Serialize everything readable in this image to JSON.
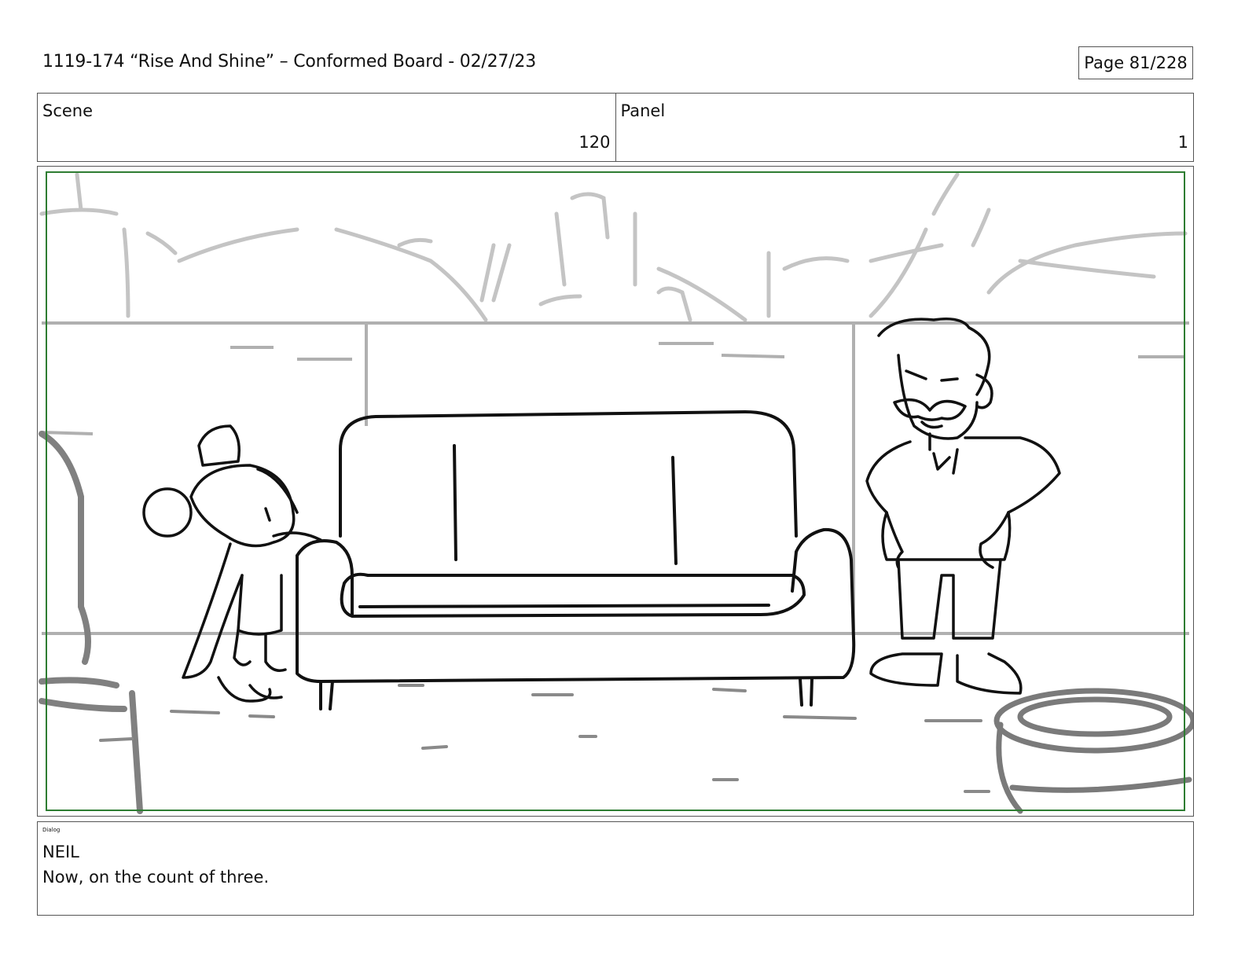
{
  "header": {
    "title": "1119-174 “Rise And Shine” – Conformed Board - 02/27/23",
    "page": "Page  81/228"
  },
  "info": {
    "scene_label": "Scene",
    "scene_value": "120",
    "panel_label": "Panel",
    "panel_value": "1"
  },
  "dialog": {
    "label": "Dialog",
    "speaker": "NEIL",
    "line": "Now, on the count of three."
  },
  "colors": {
    "border": "#555555",
    "safe_frame": "#2e7d32",
    "sketch_dark": "#111111",
    "sketch_light": "#bdbdbd",
    "sketch_mid": "#7a7a7a"
  }
}
